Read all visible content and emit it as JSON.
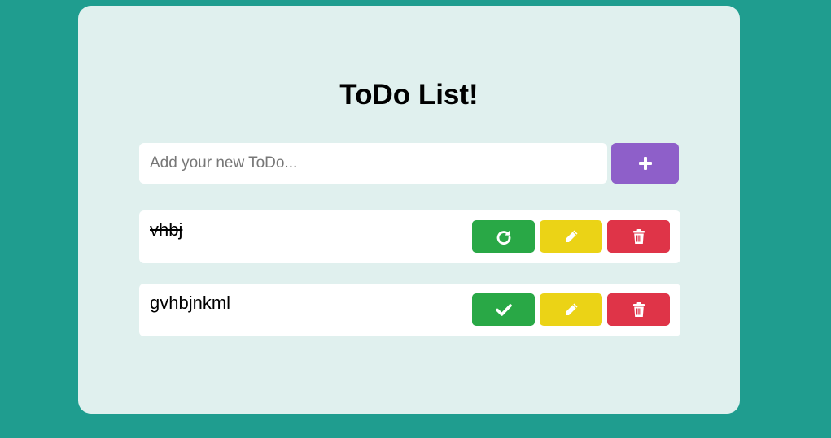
{
  "app": {
    "title": "ToDo List!"
  },
  "new_todo": {
    "placeholder": "Add your new ToDo...",
    "value": "",
    "add_icon": "plus-icon"
  },
  "todos": [
    {
      "text": "vhbj",
      "completed": true,
      "toggle_icon": "redo-icon",
      "edit_icon": "pencil-icon",
      "delete_icon": "trash-icon"
    },
    {
      "text": "gvhbjnkml",
      "completed": false,
      "toggle_icon": "check-icon",
      "edit_icon": "pencil-icon",
      "delete_icon": "trash-icon"
    }
  ],
  "colors": {
    "background": "#1f9d8f",
    "card": "#e0f0ee",
    "add_button": "#8e5fc9",
    "toggle_button": "#29a846",
    "edit_button": "#ebd316",
    "delete_button": "#df3448"
  }
}
